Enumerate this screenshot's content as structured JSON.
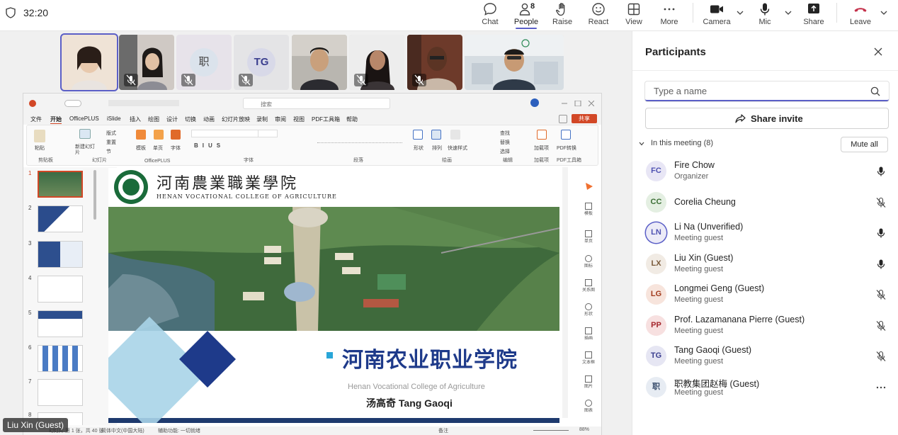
{
  "topbar": {
    "timer": "32:20",
    "chat_label": "Chat",
    "people_label": "People",
    "people_count": "8",
    "raise_label": "Raise",
    "react_label": "React",
    "view_label": "View",
    "more_label": "More",
    "camera_label": "Camera",
    "mic_label": "Mic",
    "share_label": "Share",
    "leave_label": "Leave",
    "leave_color": "#c4314b",
    "accent_color": "#5b5fc7"
  },
  "video_strip": [
    {
      "kind": "video",
      "muted": false,
      "selected": true
    },
    {
      "kind": "video",
      "muted": true,
      "selected": false
    },
    {
      "kind": "avatar",
      "initials": "职",
      "muted": true,
      "selected": false
    },
    {
      "kind": "avatar",
      "initials": "TG",
      "muted": true,
      "selected": false
    },
    {
      "kind": "video",
      "muted": false,
      "selected": false
    },
    {
      "kind": "video",
      "muted": true,
      "selected": false
    },
    {
      "kind": "video",
      "muted": true,
      "selected": false
    },
    {
      "kind": "video",
      "muted": false,
      "selected": false
    }
  ],
  "presentation": {
    "search_placeholder": "搜索",
    "share_button": "共享",
    "menu": [
      "文件",
      "开始",
      "OfficePLUS",
      "iSlide",
      "插入",
      "绘图",
      "设计",
      "切换",
      "动画",
      "幻灯片放映",
      "录制",
      "审阅",
      "视图",
      "PDF工具箱",
      "帮助"
    ],
    "ribbon_groups": [
      "剪贴板",
      "幻灯片",
      "OfficePLUS",
      "字体",
      "段落",
      "绘画",
      "编辑",
      "加载项",
      "PDF工具箱"
    ],
    "ribbon_buttons": [
      "粘贴",
      "新建幻灯片",
      "版式",
      "重置",
      "节",
      "模板",
      "单页",
      "字体",
      "形状",
      "排列",
      "快速样式",
      "查找",
      "替换",
      "选择",
      "加载项",
      "PDF转换"
    ],
    "slide_numbers": [
      "1",
      "2",
      "3",
      "4",
      "5",
      "6",
      "7",
      "8"
    ],
    "slide": {
      "header_cn": "河南農業職業學院",
      "header_en": "HENAN VOCATIONAL COLLEGE OF AGRICULTURE",
      "title_cn": "河南农业职业学院",
      "subtitle_en": "Henan Vocational College of Agriculture",
      "presenter": "汤高奇   Tang Gaoqi"
    },
    "side_tools": [
      "模板",
      "单页",
      "图标",
      "关系图",
      "形状",
      "插画",
      "文本框",
      "图片",
      "图表"
    ],
    "status": {
      "slide_info": "幻灯片 第 1 张，共 40 张",
      "language": "简体中文(中国大陆)",
      "accessibility": "辅助功能: 一切就绪",
      "notes": "备注",
      "zoom": "88%"
    }
  },
  "name_tag": "Liu Xin (Guest)",
  "participants_panel": {
    "title": "Participants",
    "search_placeholder": "Type a name",
    "share_invite_label": "Share invite",
    "meeting_header": "In this meeting (8)",
    "mute_all_label": "Mute all",
    "participants": [
      {
        "initials": "FC",
        "name": "Fire Chow",
        "role": "Organizer",
        "mic": "on",
        "avatar_bg": "#e8e6f5",
        "avatar_fg": "#4f52b2"
      },
      {
        "initials": "CC",
        "name": "Corelia Cheung",
        "role": "",
        "mic": "off",
        "avatar_bg": "#e4efe2",
        "avatar_fg": "#3b6e35"
      },
      {
        "initials": "LN",
        "name": "Li Na (Unverified)",
        "role": "Meeting guest",
        "mic": "on",
        "avatar_bg": "#ecebf7",
        "avatar_fg": "#4f52b2",
        "ring": true
      },
      {
        "initials": "LX",
        "name": "Liu Xin (Guest)",
        "role": "Meeting guest",
        "mic": "on",
        "avatar_bg": "#f1ebe4",
        "avatar_fg": "#7a5a3a"
      },
      {
        "initials": "LG",
        "name": "Longmei Geng (Guest)",
        "role": "Meeting guest",
        "mic": "off",
        "avatar_bg": "#f7e4dc",
        "avatar_fg": "#a1391b"
      },
      {
        "initials": "PP",
        "name": "Prof. Lazamanana Pierre (Guest)",
        "role": "Meeting guest",
        "mic": "off",
        "avatar_bg": "#f7e0e0",
        "avatar_fg": "#a4262c"
      },
      {
        "initials": "TG",
        "name": "Tang Gaoqi (Guest)",
        "role": "Meeting guest",
        "mic": "off",
        "avatar_bg": "#e6e6f3",
        "avatar_fg": "#3b3f8f"
      },
      {
        "initials": "职",
        "name": "职教集团赵梅 (Guest)",
        "role": "Meeting guest",
        "mic": "more",
        "avatar_bg": "#e7ecf3",
        "avatar_fg": "#3b4f6e"
      }
    ]
  }
}
